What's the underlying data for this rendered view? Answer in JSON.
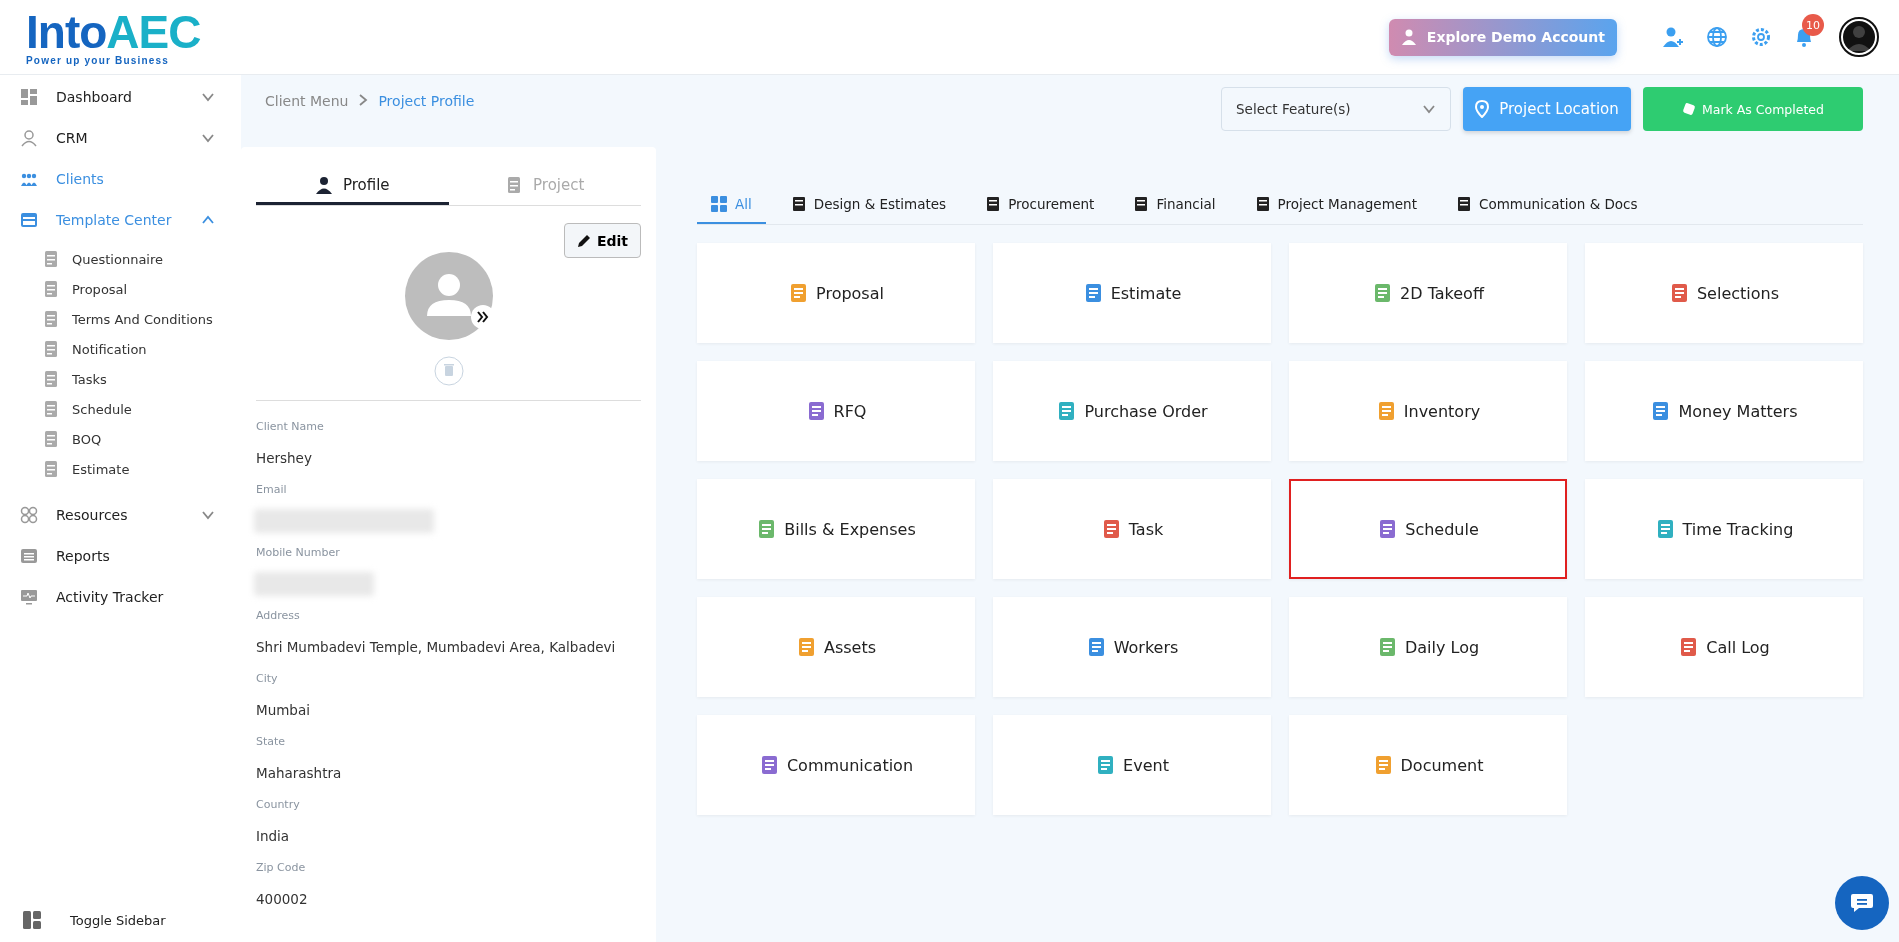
{
  "header": {
    "logo": {
      "word": "Into",
      "accent": "AEC",
      "tagline": "Power up your Business"
    },
    "demo_button": "Explore Demo Account",
    "notification_count": "10"
  },
  "sidebar": {
    "items": [
      {
        "label": "Dashboard",
        "selected": false,
        "expanded": false
      },
      {
        "label": "CRM",
        "selected": false,
        "expanded": false
      },
      {
        "label": "Clients",
        "selected": true
      },
      {
        "label": "Template Center",
        "selected": true,
        "expanded": true,
        "children": [
          {
            "label": "Questionnaire"
          },
          {
            "label": "Proposal"
          },
          {
            "label": "Terms And Conditions"
          },
          {
            "label": "Notification"
          },
          {
            "label": "Tasks"
          },
          {
            "label": "Schedule"
          },
          {
            "label": "BOQ"
          },
          {
            "label": "Estimate"
          }
        ]
      },
      {
        "label": "Resources",
        "selected": false,
        "expanded": false
      },
      {
        "label": "Reports",
        "selected": false
      },
      {
        "label": "Activity Tracker",
        "selected": false
      }
    ],
    "toggle": "Toggle Sidebar"
  },
  "breadcrumb": [
    "Client Menu",
    "Project Profile"
  ],
  "profile": {
    "tabs": [
      {
        "label": "Profile",
        "selected": true
      },
      {
        "label": "Project",
        "selected": false
      }
    ],
    "edit_button": "Edit",
    "fields": [
      {
        "label": "Client Name",
        "value": "Hershey"
      },
      {
        "label": "Email",
        "kind": "redacted"
      },
      {
        "label": "Mobile Number",
        "kind": "redacted"
      },
      {
        "label": "Address",
        "value": "Shri Mumbadevi Temple, Mumbadevi Area, Kalbadevi"
      },
      {
        "label": "City",
        "value": "Mumbai"
      },
      {
        "label": "State",
        "value": "Maharashtra"
      },
      {
        "label": "Country",
        "value": "India"
      },
      {
        "label": "Zip Code",
        "value": "400002"
      }
    ]
  },
  "toolbar": {
    "select": {
      "placeholder": "Select Feature(s)"
    },
    "location_button": "Project Location",
    "complete_button": "Mark As Completed"
  },
  "category_tabs": [
    {
      "label": "All",
      "selected": true
    },
    {
      "label": "Design & Estimates",
      "selected": false
    },
    {
      "label": "Procurement",
      "selected": false
    },
    {
      "label": "Financial",
      "selected": false
    },
    {
      "label": "Project Management",
      "selected": false
    },
    {
      "label": "Communication & Docs",
      "selected": false
    }
  ],
  "tiles": [
    {
      "label": "Proposal",
      "selected": false
    },
    {
      "label": "Estimate",
      "selected": false
    },
    {
      "label": "2D Takeoff",
      "selected": false
    },
    {
      "label": "Selections",
      "selected": false
    },
    {
      "label": "RFQ",
      "selected": false
    },
    {
      "label": "Purchase Order",
      "selected": false
    },
    {
      "label": "Inventory",
      "selected": false
    },
    {
      "label": "Money Matters",
      "selected": false
    },
    {
      "label": "Bills & Expenses",
      "selected": false
    },
    {
      "label": "Task",
      "selected": false
    },
    {
      "label": "Schedule",
      "selected": true
    },
    {
      "label": "Time Tracking",
      "selected": false
    },
    {
      "label": "Assets",
      "selected": false
    },
    {
      "label": "Workers",
      "selected": false
    },
    {
      "label": "Daily Log",
      "selected": false
    },
    {
      "label": "Call Log",
      "selected": false
    },
    {
      "label": "Communication",
      "selected": false
    },
    {
      "label": "Event",
      "selected": false
    },
    {
      "label": "Document",
      "selected": false
    }
  ]
}
